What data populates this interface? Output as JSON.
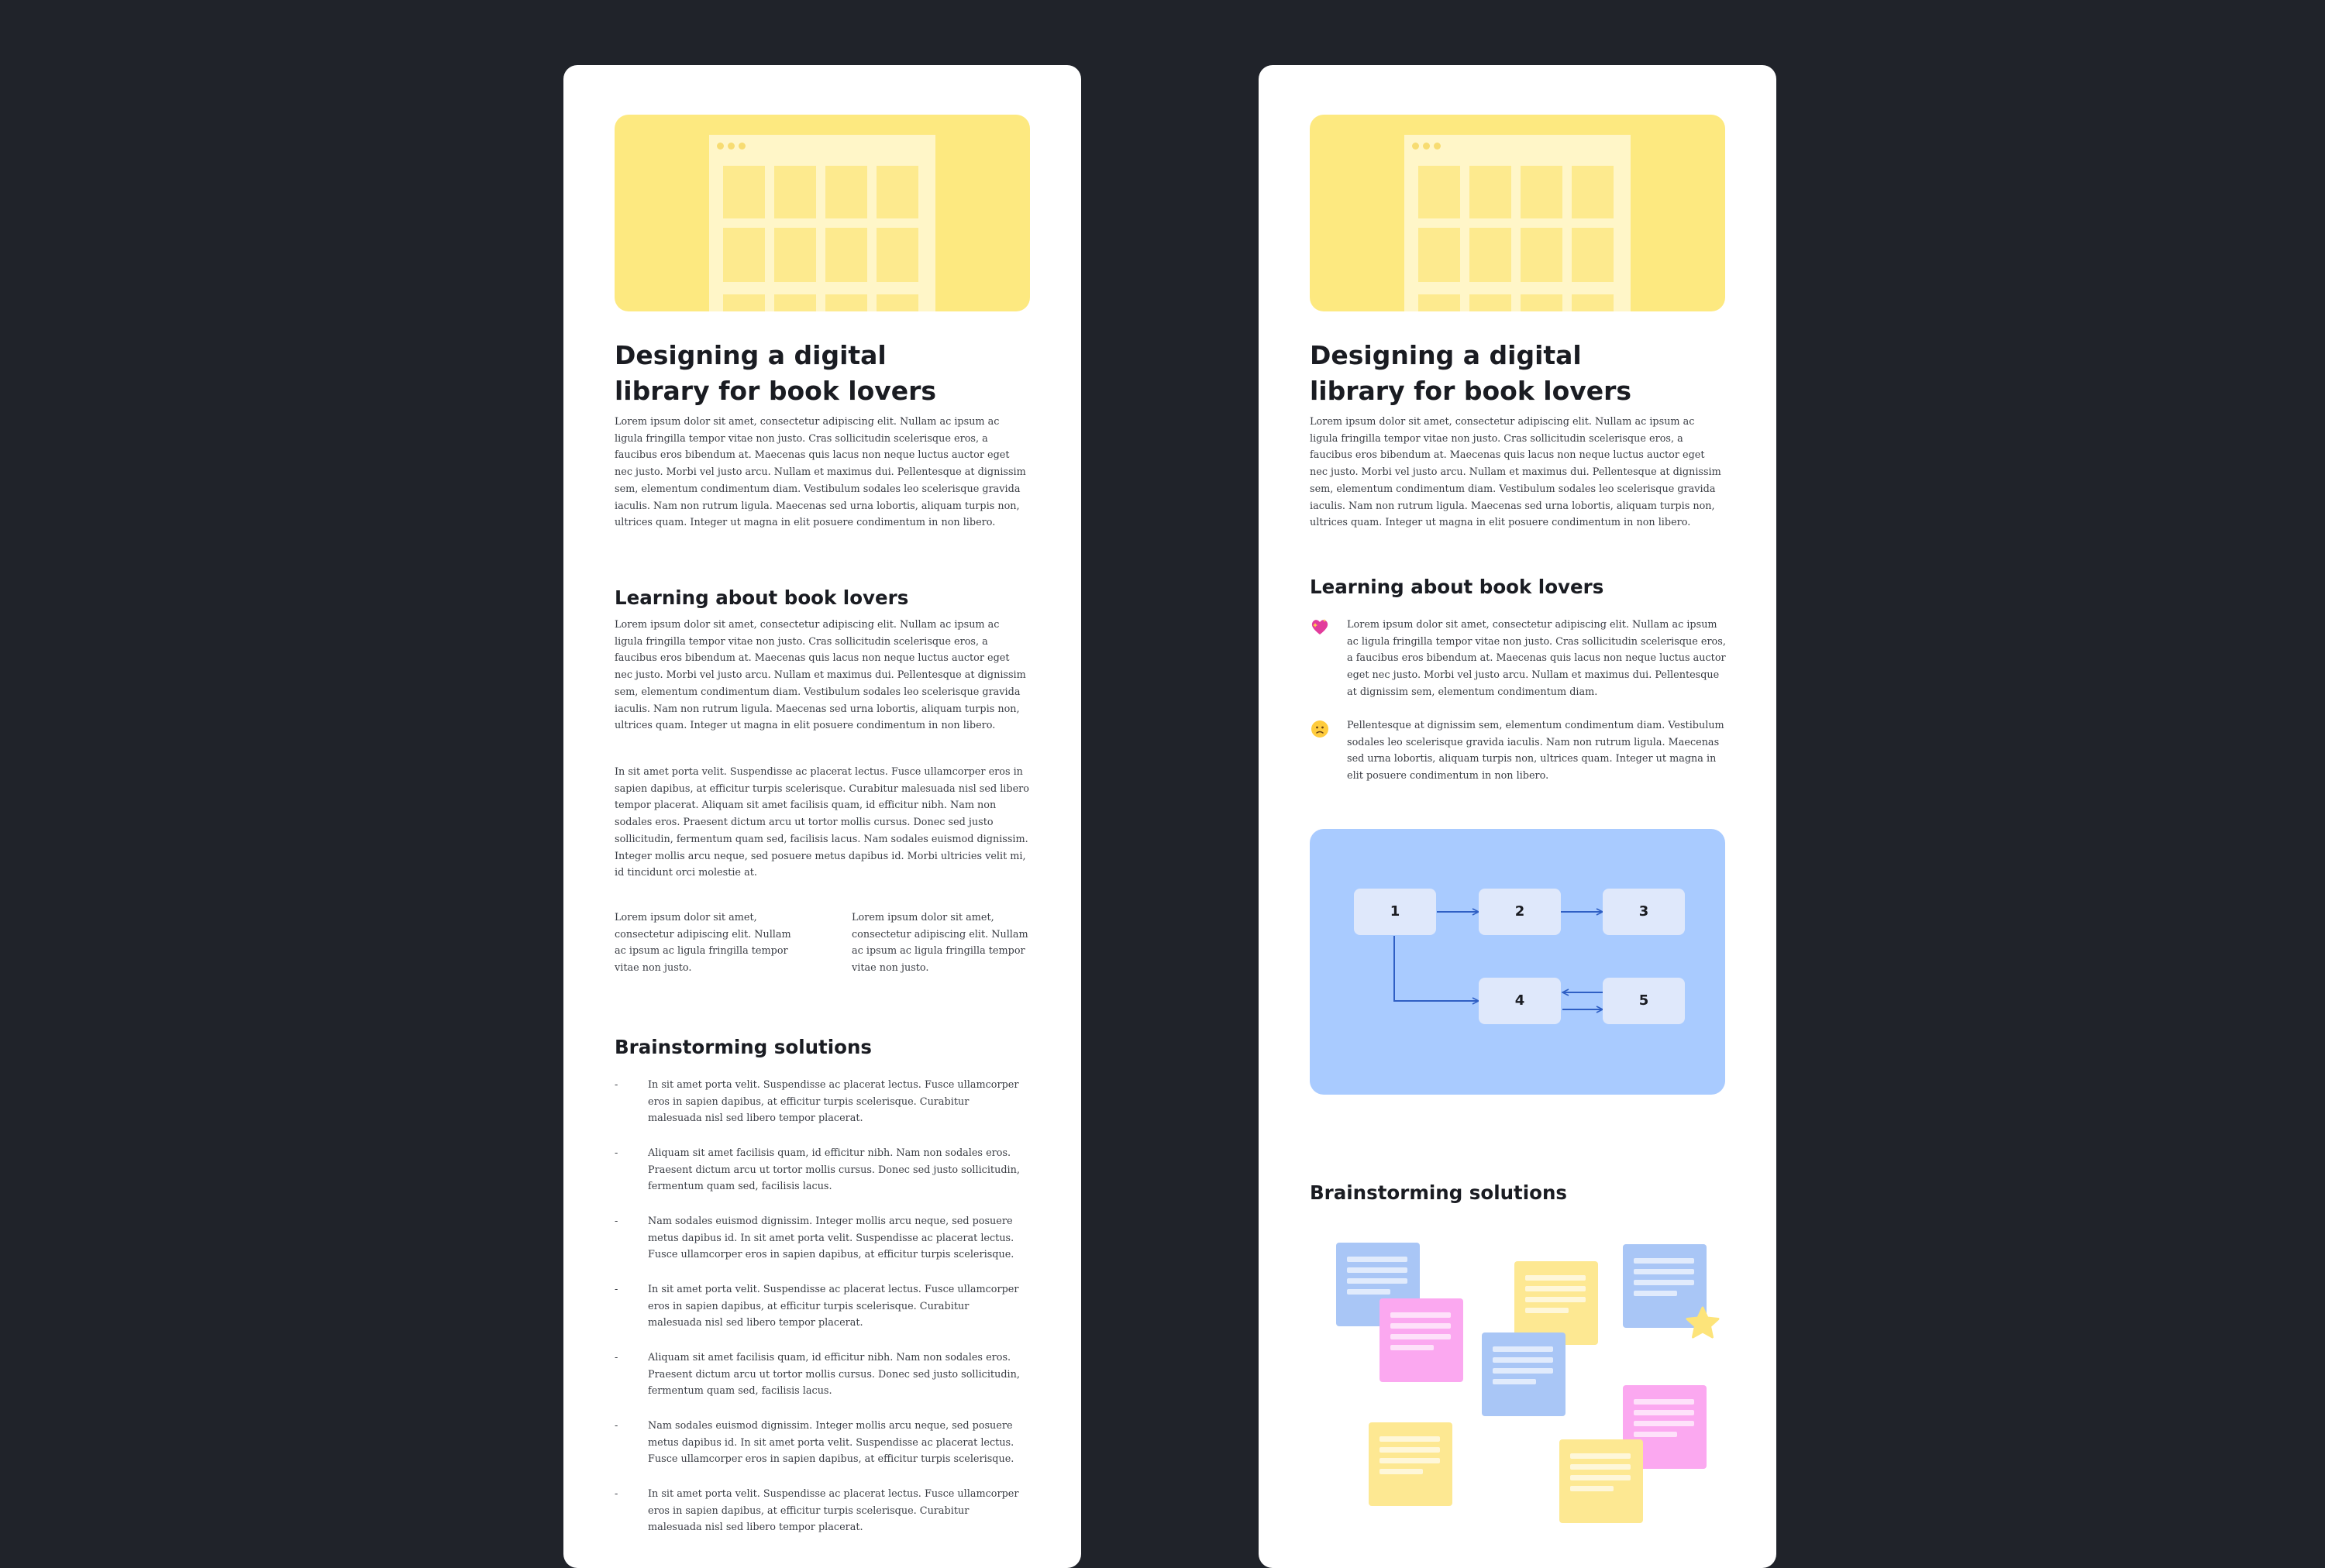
{
  "colors": {
    "background": "#20232a",
    "card": "#ffffff",
    "hero_yellow": "#fde980",
    "flow_blue": "#a9cbff",
    "arrow_blue": "#2f5fc4",
    "note_blue": "#a9c6f6",
    "note_pink": "#fba8f0",
    "note_yellow": "#fde892"
  },
  "left": {
    "title": "Designing a digital library for book lovers",
    "intro": "Lorem ipsum dolor sit amet, consectetur adipiscing elit. Nullam ac ipsum ac ligula fringilla tempor vitae non justo. Cras sollicitudin scelerisque eros, a faucibus eros bibendum at. Maecenas quis lacus non neque luctus auctor eget nec justo. Morbi vel justo arcu. Nullam et maximus dui. Pellentesque at dignissim sem, elementum condimentum diam. Vestibulum sodales leo scelerisque gravida iaculis. Nam non rutrum ligula. Maecenas sed urna lobortis, aliquam turpis non, ultrices quam. Integer ut magna in elit posuere condimentum in non libero.",
    "section1_heading": "Learning about book lovers",
    "section1_p1": "Lorem ipsum dolor sit amet, consectetur adipiscing elit. Nullam ac ipsum ac ligula fringilla tempor vitae non justo. Cras sollicitudin scelerisque eros, a faucibus eros bibendum at. Maecenas quis lacus non neque luctus auctor eget nec justo. Morbi vel justo arcu. Nullam et maximus dui. Pellentesque at dignissim sem, elementum condimentum diam. Vestibulum sodales leo scelerisque gravida iaculis. Nam non rutrum ligula. Maecenas sed urna lobortis, aliquam turpis non, ultrices quam. Integer ut magna in elit posuere condimentum in non libero.",
    "section1_p2": "In sit amet porta velit. Suspendisse ac placerat lectus. Fusce ullamcorper eros in sapien dapibus, at efficitur turpis scelerisque. Curabitur malesuada nisl sed libero tempor placerat. Aliquam sit amet facilisis quam, id efficitur nibh. Nam non sodales eros. Praesent dictum arcu ut tortor mollis cursus. Donec sed justo sollicitudin, fermentum quam sed, facilisis lacus. Nam sodales euismod dignissim. Integer mollis arcu neque, sed posuere metus dapibus id. Morbi ultricies velit mi, id tincidunt orci molestie at.",
    "col_left": "Lorem ipsum dolor sit amet, consectetur adipiscing elit. Nullam ac ipsum ac ligula fringilla tempor vitae non justo.",
    "col_right": "Lorem ipsum dolor sit amet, consectetur adipiscing elit. Nullam ac ipsum ac ligula fringilla tempor vitae non justo.",
    "section2_heading": "Brainstorming solutions",
    "bullet_marker": "-",
    "bullets": [
      "In sit amet porta velit. Suspendisse ac placerat lectus. Fusce ullamcorper eros in sapien dapibus, at efficitur turpis scelerisque. Curabitur malesuada nisl sed libero tempor placerat.",
      "Aliquam sit amet facilisis quam, id efficitur nibh. Nam non sodales eros. Praesent dictum arcu ut tortor mollis cursus.  Donec sed justo sollicitudin, fermentum quam sed, facilisis lacus.",
      "Nam sodales euismod dignissim. Integer mollis arcu neque, sed posuere metus dapibus id. In sit amet porta velit. Suspendisse ac placerat lectus. Fusce ullamcorper eros in sapien dapibus, at efficitur turpis scelerisque.",
      "In sit amet porta velit. Suspendisse ac placerat lectus. Fusce ullamcorper eros in sapien dapibus, at efficitur turpis scelerisque. Curabitur malesuada nisl sed libero tempor placerat.",
      "Aliquam sit amet facilisis quam, id efficitur nibh. Nam non sodales eros. Praesent dictum arcu ut tortor mollis cursus.  Donec sed justo sollicitudin, fermentum quam sed, facilisis lacus.",
      "Nam sodales euismod dignissim. Integer mollis arcu neque, sed posuere metus dapibus id. In sit amet porta velit. Suspendisse ac placerat lectus. Fusce ullamcorper eros in sapien dapibus, at efficitur turpis scelerisque.",
      "In sit amet porta velit. Suspendisse ac placerat lectus. Fusce ullamcorper eros in sapien dapibus, at efficitur turpis scelerisque. Curabitur malesuada nisl sed libero tempor placerat."
    ]
  },
  "right": {
    "title": "Designing a digital library for book lovers",
    "intro": "Lorem ipsum dolor sit amet, consectetur adipiscing elit. Nullam ac ipsum ac ligula fringilla tempor vitae non justo. Cras sollicitudin scelerisque eros, a faucibus eros bibendum at. Maecenas quis lacus non neque luctus auctor eget nec justo. Morbi vel justo arcu. Nullam et maximus dui. Pellentesque at dignissim sem, elementum condimentum diam. Vestibulum sodales leo scelerisque gravida iaculis. Nam non rutrum ligula. Maecenas sed urna lobortis, aliquam turpis non, ultrices quam. Integer ut magna in elit posuere condimentum in non libero.",
    "section1_heading": "Learning about book lovers",
    "insights": [
      {
        "icon": "sparkling-heart-icon",
        "text": "Lorem ipsum dolor sit amet, consectetur adipiscing elit. Nullam ac ipsum ac ligula fringilla tempor vitae non justo. Cras sollicitudin scelerisque eros, a faucibus eros bibendum at. Maecenas quis lacus non neque luctus auctor eget nec justo. Morbi vel justo arcu. Nullam et maximus dui. Pellentesque at dignissim sem, elementum condimentum diam."
      },
      {
        "icon": "slightly-frowning-face-icon",
        "text": "Pellentesque at dignissim sem, elementum condimentum diam. Vestibulum sodales leo scelerisque gravida iaculis. Nam non rutrum ligula. Maecenas sed urna lobortis, aliquam turpis non, ultrices quam. Integer ut magna in elit posuere condimentum in non libero."
      }
    ],
    "flow_nodes": [
      "1",
      "2",
      "3",
      "4",
      "5"
    ],
    "section2_heading": "Brainstorming solutions",
    "sticky_notes": [
      "blue",
      "pink",
      "yellow",
      "blue",
      "blue",
      "pink",
      "yellow",
      "yellow"
    ],
    "star_icon": "star-icon"
  }
}
